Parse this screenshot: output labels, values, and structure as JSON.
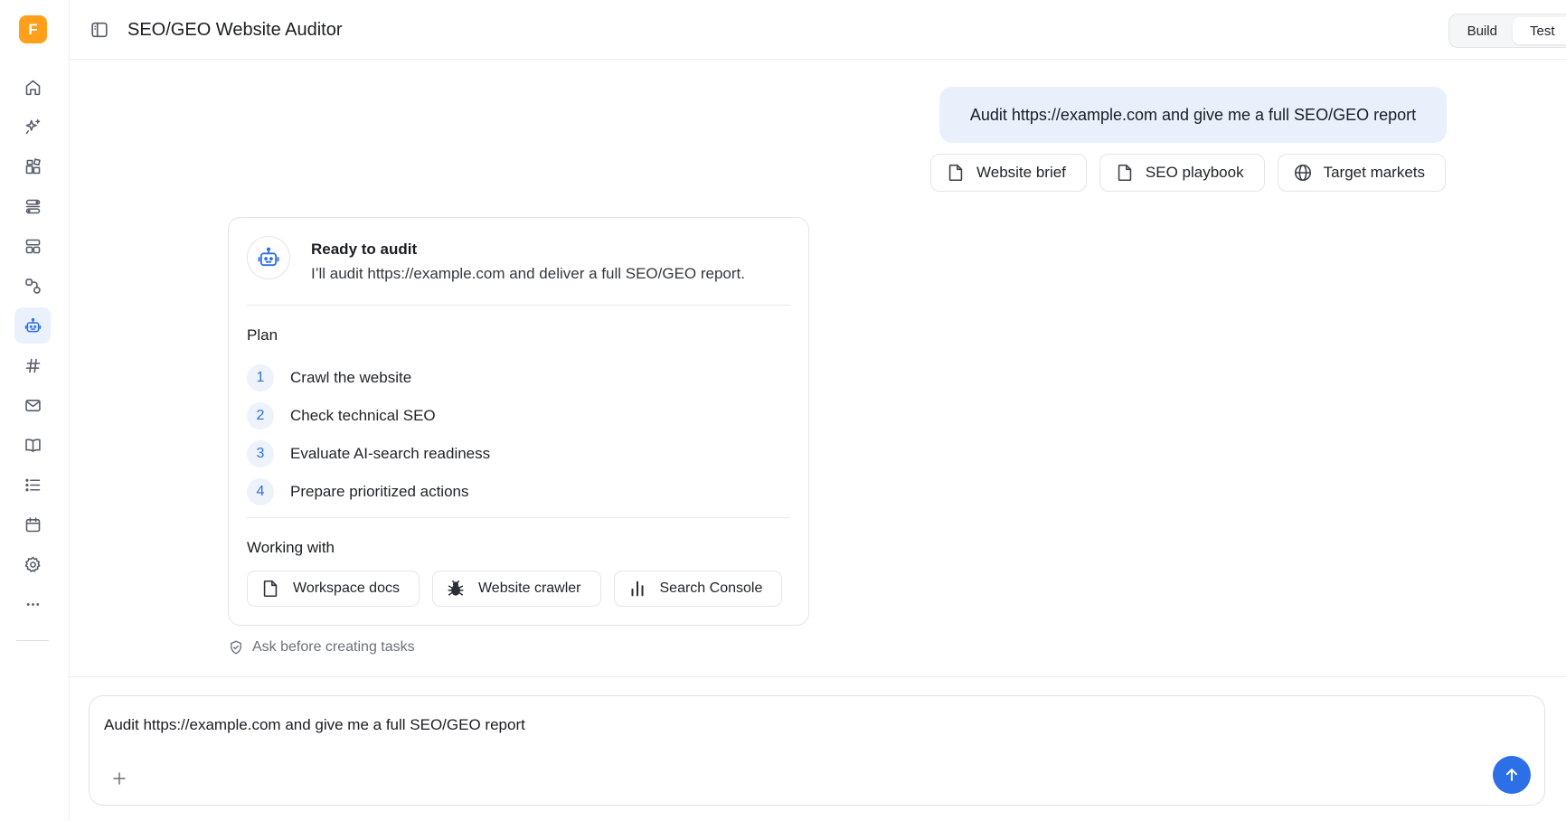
{
  "app": {
    "logo_letter": "F",
    "title": "SEO/GEO Website Auditor",
    "accent_color": "#2d6fe6",
    "logo_color": "#ff9f1a"
  },
  "sidebar": {
    "items": [
      {
        "name": "home",
        "icon": "home-icon"
      },
      {
        "name": "ai-sparkle",
        "icon": "sparkle-icon"
      },
      {
        "name": "apps",
        "icon": "apps-icon"
      },
      {
        "name": "flows",
        "icon": "flows-icon"
      },
      {
        "name": "layouts",
        "icon": "layout-icon"
      },
      {
        "name": "integrations",
        "icon": "integrations-icon"
      },
      {
        "name": "agents",
        "icon": "robot-icon",
        "active": true
      },
      {
        "name": "channels",
        "icon": "hash-icon"
      },
      {
        "name": "mail",
        "icon": "mail-icon"
      },
      {
        "name": "knowledge",
        "icon": "book-icon"
      },
      {
        "name": "lists",
        "icon": "list-icon"
      },
      {
        "name": "calendar",
        "icon": "calendar-icon"
      },
      {
        "name": "settings",
        "icon": "gear-icon"
      },
      {
        "name": "more",
        "icon": "more-icon"
      }
    ]
  },
  "header": {
    "build_label": "Build",
    "test_label": "Test",
    "active_mode": "Test"
  },
  "user_message": {
    "text": "Audit https://example.com and give me a full SEO/GEO report",
    "attachments": [
      {
        "label": "Website brief",
        "icon": "file-icon"
      },
      {
        "label": "SEO playbook",
        "icon": "file-icon"
      },
      {
        "label": "Target markets",
        "icon": "globe-icon"
      }
    ]
  },
  "assistant_card": {
    "title": "Ready to audit",
    "subtitle": "I’ll audit https://example.com and deliver a full SEO/GEO report.",
    "plan_label": "Plan",
    "plan": [
      {
        "num": "1",
        "text": "Crawl the website"
      },
      {
        "num": "2",
        "text": "Check technical SEO"
      },
      {
        "num": "3",
        "text": "Evaluate AI-search readiness"
      },
      {
        "num": "4",
        "text": "Prepare prioritized actions"
      }
    ],
    "working_with_label": "Working with",
    "tools": [
      {
        "label": "Workspace docs",
        "icon": "file-icon"
      },
      {
        "label": "Website crawler",
        "icon": "bug-icon"
      },
      {
        "label": "Search Console",
        "icon": "bar-chart-icon"
      }
    ]
  },
  "permission_note": "Ask before creating tasks",
  "composer": {
    "value": "Audit https://example.com and give me a full SEO/GEO report"
  }
}
